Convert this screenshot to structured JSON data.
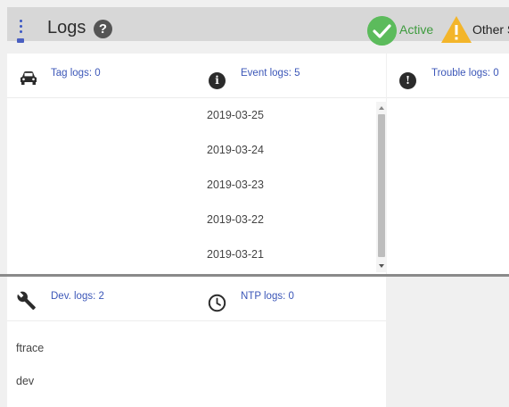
{
  "header": {
    "title": "Logs",
    "help_glyph": "?",
    "status_active": "Active",
    "status_other": "Other St",
    "active_color": "#5cbb5c",
    "warning_color": "#f3b52a"
  },
  "panels": {
    "tag": {
      "title": "Tag logs: 0",
      "icon": "car-icon"
    },
    "event": {
      "title": "Event logs: 5",
      "icon": "info-icon",
      "icon_glyph": "i",
      "items": [
        "2019-03-25",
        "2019-03-24",
        "2019-03-23",
        "2019-03-22",
        "2019-03-21"
      ]
    },
    "trouble": {
      "title": "Trouble logs: 0",
      "icon": "alert-icon",
      "icon_glyph": "!"
    },
    "dev": {
      "title": "Dev. logs: 2",
      "icon": "wrench-icon",
      "items": [
        "ftrace",
        "dev"
      ]
    },
    "ntp": {
      "title": "NTP logs: 0",
      "icon": "clock-icon"
    }
  },
  "accent_color": "#3c57b8"
}
